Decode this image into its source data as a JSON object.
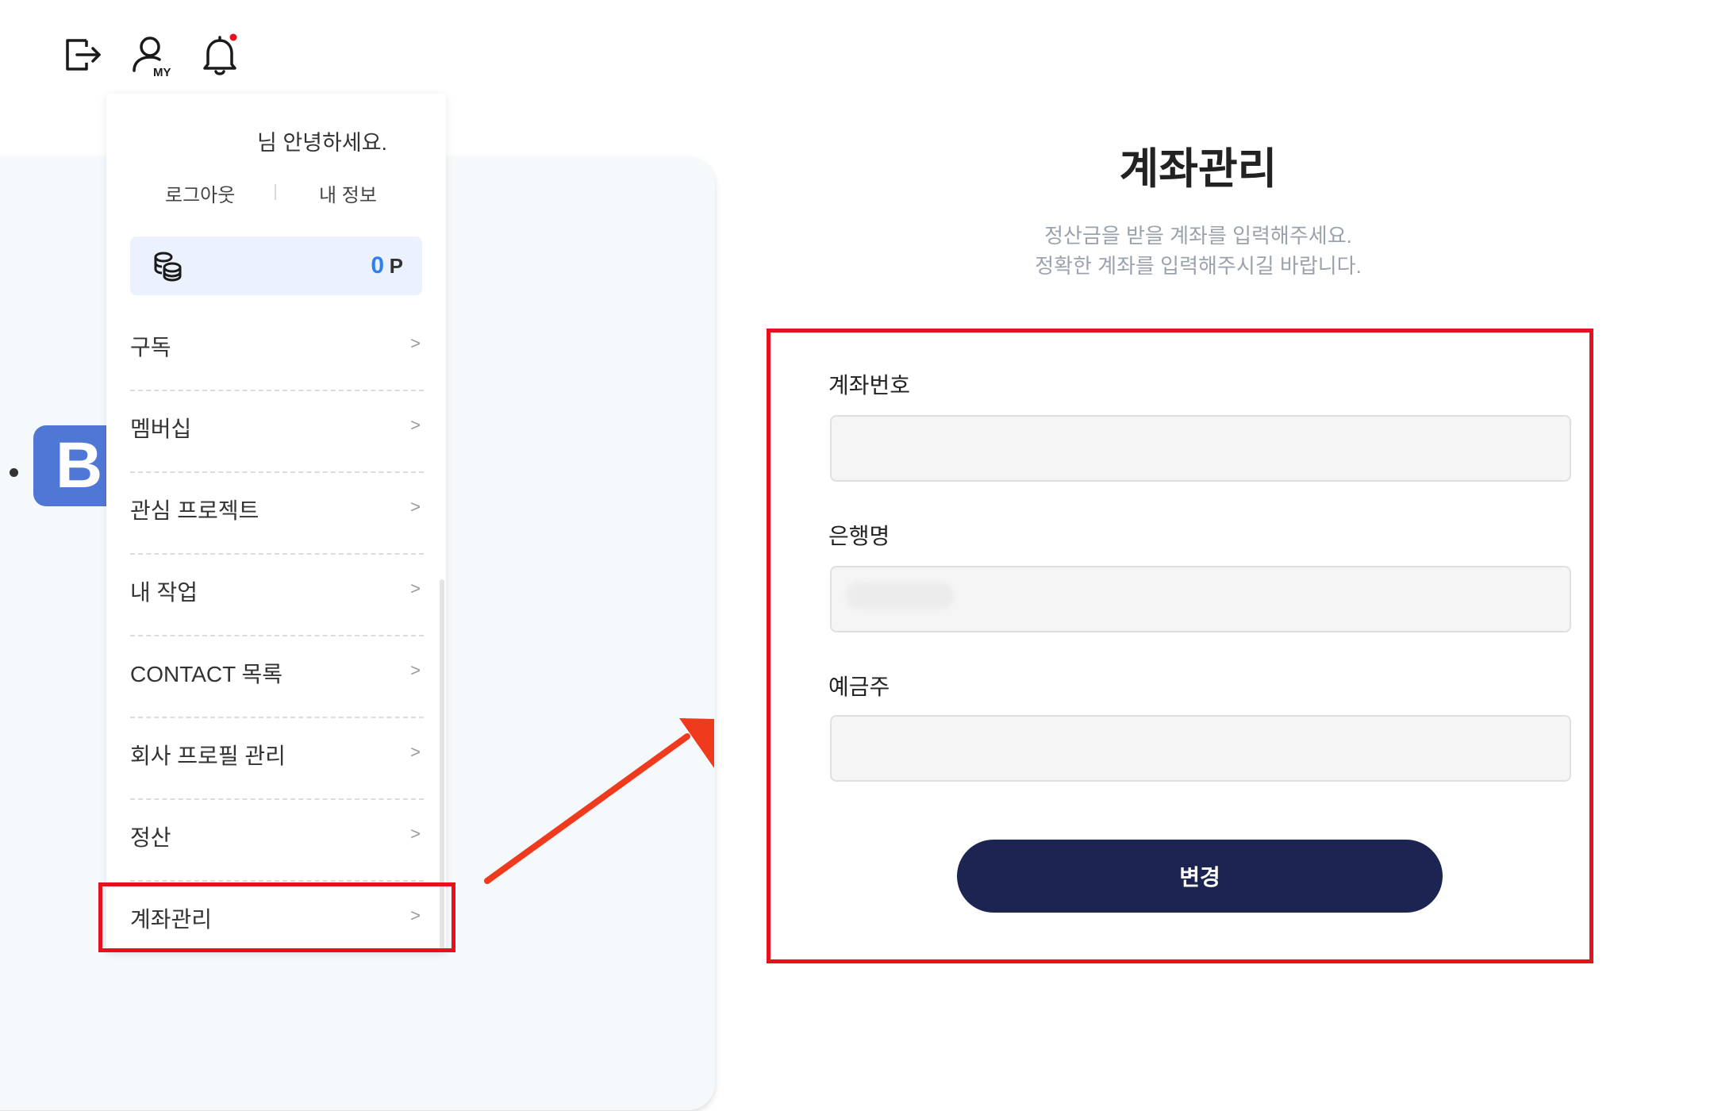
{
  "header": {
    "icons": [
      "logout-icon",
      "my-page-icon",
      "notification-bell-icon"
    ],
    "my_badge": "MY",
    "notification_dot_color": "#e8101c"
  },
  "dropdown": {
    "greeting": "님 안녕하세요.",
    "logout_label": "로그아웃",
    "my_info_label": "내 정보",
    "points": {
      "value": "0",
      "unit": "P",
      "icon": "coins-icon"
    },
    "menu_items": [
      {
        "label": "구독"
      },
      {
        "label": "멤버십"
      },
      {
        "label": "관심 프로젝트"
      },
      {
        "label": "내 작업"
      },
      {
        "label": "CONTACT 목록"
      },
      {
        "label": "회사 프로필 관리"
      },
      {
        "label": "정산"
      },
      {
        "label": "계좌관리"
      }
    ],
    "chevron": ">"
  },
  "background": {
    "logo_letter": "B"
  },
  "account_panel": {
    "title": "계좌관리",
    "description_line1": "정산금을 받을 계좌를 입력해주세요.",
    "description_line2": "정확한 계좌를 입력해주시길 바랍니다.",
    "fields": {
      "account_number": {
        "label": "계좌번호",
        "value": ""
      },
      "bank_name": {
        "label": "은행명",
        "value": ""
      },
      "account_holder": {
        "label": "예금주",
        "value": ""
      }
    },
    "submit_label": "변경"
  },
  "annotation": {
    "highlight_color": "#e8101c",
    "arrow_color": "#f03a1e"
  }
}
